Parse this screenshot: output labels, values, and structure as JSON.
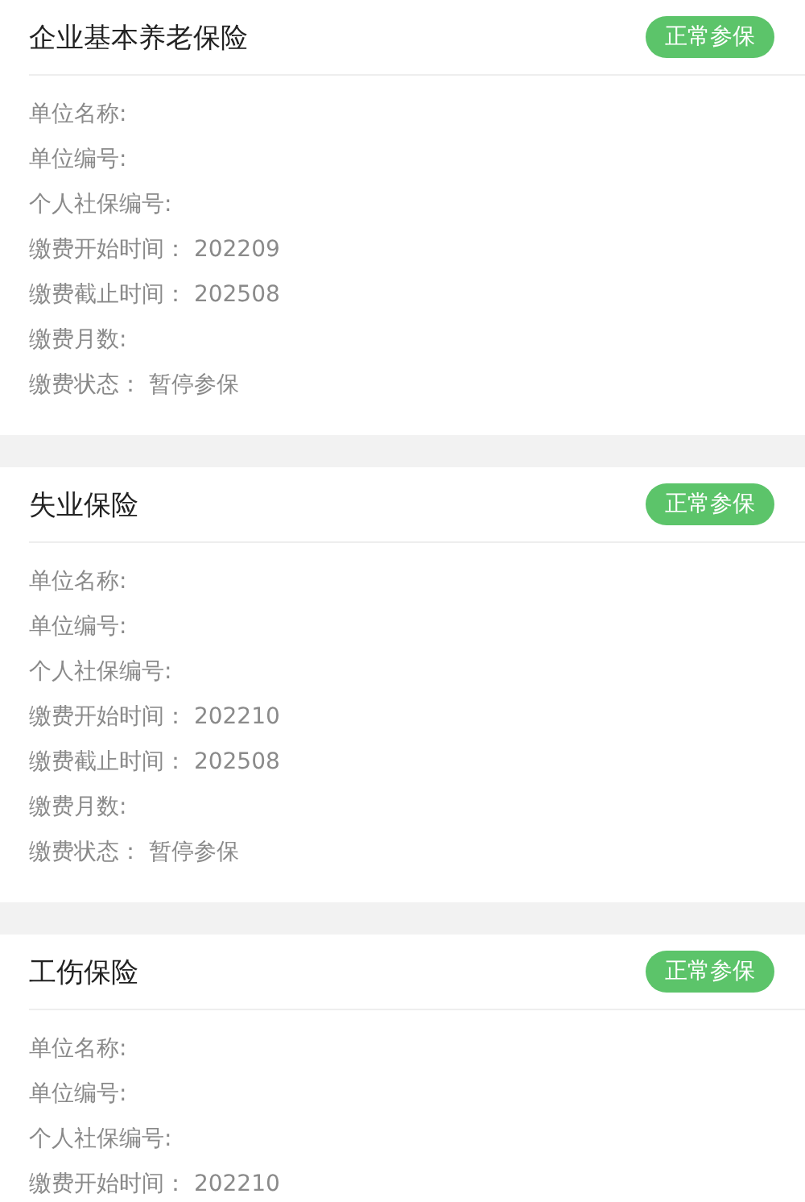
{
  "cards": [
    {
      "title": "企业基本养老保险",
      "status": "正常参保",
      "fields": [
        {
          "label": "单位名称:"
        },
        {
          "label": "单位编号:"
        },
        {
          "label": "个人社保编号:"
        },
        {
          "label": "缴费开始时间：",
          "value": "202209"
        },
        {
          "label": "缴费截止时间：",
          "value": "202508"
        },
        {
          "label": "缴费月数:"
        },
        {
          "label": "缴费状态：",
          "value": "暂停参保"
        }
      ]
    },
    {
      "title": "失业保险",
      "status": "正常参保",
      "fields": [
        {
          "label": "单位名称:"
        },
        {
          "label": "单位编号:"
        },
        {
          "label": "个人社保编号:"
        },
        {
          "label": "缴费开始时间：",
          "value": "202210"
        },
        {
          "label": "缴费截止时间：",
          "value": "202508"
        },
        {
          "label": "缴费月数:"
        },
        {
          "label": "缴费状态：",
          "value": "暂停参保"
        }
      ]
    },
    {
      "title": "工伤保险",
      "status": "正常参保",
      "fields": [
        {
          "label": "单位名称:"
        },
        {
          "label": "单位编号:"
        },
        {
          "label": "个人社保编号:"
        },
        {
          "label": "缴费开始时间：",
          "value": "202210"
        }
      ]
    }
  ]
}
